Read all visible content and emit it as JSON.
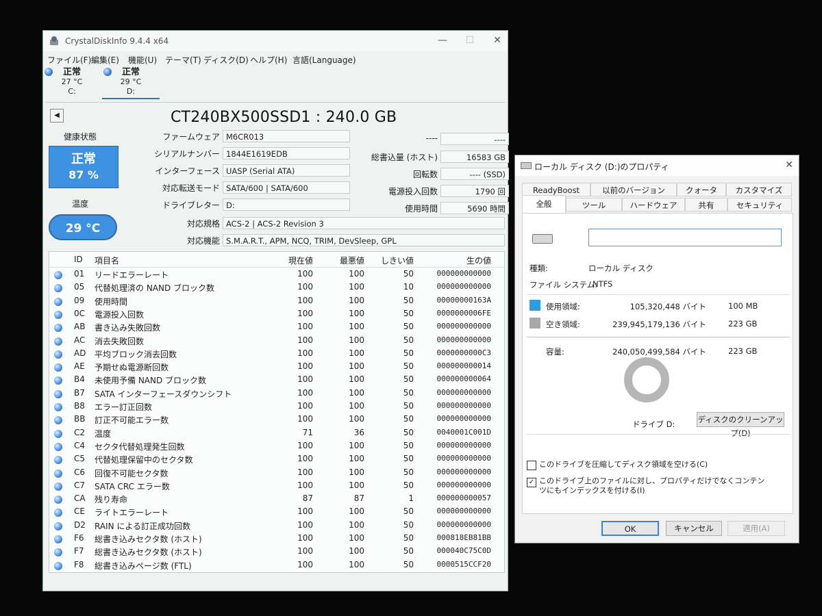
{
  "cdi": {
    "title": "CrystalDiskInfo 9.4.4 x64",
    "menu": [
      "ファイル(F)",
      "編集(E)",
      "機能(U)",
      "テーマ(T)",
      "ディスク(D)",
      "ヘルプ(H)",
      "言語(Language)"
    ],
    "drives": [
      {
        "status": "正常",
        "temp": "27 °C",
        "letter": "C:"
      },
      {
        "status": "正常",
        "temp": "29 °C",
        "letter": "D:"
      }
    ],
    "model": "CT240BX500SSD1 : 240.0 GB",
    "health_label": "健康状態",
    "health_status": "正常",
    "health_percent": "87 %",
    "temp_label": "温度",
    "temp_value": "29 °C",
    "left_fields": [
      {
        "label": "ファームウェア",
        "value": "M6CR013"
      },
      {
        "label": "シリアルナンバー",
        "value": "1844E1619EDB"
      },
      {
        "label": "インターフェース",
        "value": "UASP (Serial ATA)"
      },
      {
        "label": "対応転送モード",
        "value": "SATA/600 | SATA/600"
      },
      {
        "label": "ドライブレター",
        "value": "D:"
      }
    ],
    "right_fields": [
      {
        "label": "----",
        "value": "----"
      },
      {
        "label": "総書込量 (ホスト)",
        "value": "16583 GB"
      },
      {
        "label": "回転数",
        "value": "---- (SSD)"
      },
      {
        "label": "電源投入回数",
        "value": "1790 回"
      },
      {
        "label": "使用時間",
        "value": "5690 時間"
      }
    ],
    "standard_label": "対応規格",
    "standard_value": "ACS-2 | ACS-2 Revision 3",
    "features_label": "対応機能",
    "features_value": "S.M.A.R.T., APM, NCQ, TRIM, DevSleep, GPL",
    "smart_headers": {
      "id": "ID",
      "name": "項目名",
      "current": "現在値",
      "worst": "最悪値",
      "threshold": "しきい値",
      "raw": "生の値"
    },
    "smart_rows": [
      {
        "id": "01",
        "name": "リードエラーレート",
        "cur": "100",
        "worst": "100",
        "th": "50",
        "raw": "000000000000"
      },
      {
        "id": "05",
        "name": "代替処理済の NAND ブロック数",
        "cur": "100",
        "worst": "100",
        "th": "10",
        "raw": "000000000000"
      },
      {
        "id": "09",
        "name": "使用時間",
        "cur": "100",
        "worst": "100",
        "th": "50",
        "raw": "00000000163A"
      },
      {
        "id": "0C",
        "name": "電源投入回数",
        "cur": "100",
        "worst": "100",
        "th": "50",
        "raw": "0000000006FE"
      },
      {
        "id": "AB",
        "name": "書き込み失敗回数",
        "cur": "100",
        "worst": "100",
        "th": "50",
        "raw": "000000000000"
      },
      {
        "id": "AC",
        "name": "消去失敗回数",
        "cur": "100",
        "worst": "100",
        "th": "50",
        "raw": "000000000000"
      },
      {
        "id": "AD",
        "name": "平均ブロック消去回数",
        "cur": "100",
        "worst": "100",
        "th": "50",
        "raw": "0000000000C3"
      },
      {
        "id": "AE",
        "name": "予期せぬ電源断回数",
        "cur": "100",
        "worst": "100",
        "th": "50",
        "raw": "000000000014"
      },
      {
        "id": "B4",
        "name": "未使用予備 NAND ブロック数",
        "cur": "100",
        "worst": "100",
        "th": "50",
        "raw": "000000000064"
      },
      {
        "id": "B7",
        "name": "SATA インターフェースダウンシフト",
        "cur": "100",
        "worst": "100",
        "th": "50",
        "raw": "000000000000"
      },
      {
        "id": "B8",
        "name": "エラー訂正回数",
        "cur": "100",
        "worst": "100",
        "th": "50",
        "raw": "000000000000"
      },
      {
        "id": "BB",
        "name": "訂正不可能エラー数",
        "cur": "100",
        "worst": "100",
        "th": "50",
        "raw": "000000000000"
      },
      {
        "id": "C2",
        "name": "温度",
        "cur": "71",
        "worst": "36",
        "th": "50",
        "raw": "0040001C001D"
      },
      {
        "id": "C4",
        "name": "セクタ代替処理発生回数",
        "cur": "100",
        "worst": "100",
        "th": "50",
        "raw": "000000000000"
      },
      {
        "id": "C5",
        "name": "代替処理保留中のセクタ数",
        "cur": "100",
        "worst": "100",
        "th": "50",
        "raw": "000000000000"
      },
      {
        "id": "C6",
        "name": "回復不可能セクタ数",
        "cur": "100",
        "worst": "100",
        "th": "50",
        "raw": "000000000000"
      },
      {
        "id": "C7",
        "name": "SATA CRC エラー数",
        "cur": "100",
        "worst": "100",
        "th": "50",
        "raw": "000000000000"
      },
      {
        "id": "CA",
        "name": "残り寿命",
        "cur": "87",
        "worst": "87",
        "th": "1",
        "raw": "000000000057"
      },
      {
        "id": "CE",
        "name": "ライトエラーレート",
        "cur": "100",
        "worst": "100",
        "th": "50",
        "raw": "000000000000"
      },
      {
        "id": "D2",
        "name": "RAIN による訂正成功回数",
        "cur": "100",
        "worst": "100",
        "th": "50",
        "raw": "000000000000"
      },
      {
        "id": "F6",
        "name": "総書き込みセクタ数 (ホスト)",
        "cur": "100",
        "worst": "100",
        "th": "50",
        "raw": "000818EB81BB"
      },
      {
        "id": "F7",
        "name": "総書き込みセクタ数 (ホスト)",
        "cur": "100",
        "worst": "100",
        "th": "50",
        "raw": "000040C75C0D"
      },
      {
        "id": "F8",
        "name": "総書き込みページ数 (FTL)",
        "cur": "100",
        "worst": "100",
        "th": "50",
        "raw": "0000515CCF20"
      }
    ]
  },
  "props": {
    "title": "ローカル ディスク (D:)のプロパティ",
    "tabs_row1": [
      "ReadyBoost",
      "以前のバージョン",
      "クォータ",
      "カスタマイズ"
    ],
    "tabs_row2": [
      "全般",
      "ツール",
      "ハードウェア",
      "共有",
      "セキュリティ"
    ],
    "name_value": "",
    "type_label": "種類:",
    "type_value": "ローカル ディスク",
    "fs_label": "ファイル システム:",
    "fs_value": "NTFS",
    "used_label": "使用領域:",
    "used_bytes": "105,320,448 バイト",
    "used_size": "100 MB",
    "free_label": "空き領域:",
    "free_bytes": "239,945,179,136 バイト",
    "free_size": "223 GB",
    "cap_label": "容量:",
    "cap_bytes": "240,050,499,584 バイト",
    "cap_size": "223 GB",
    "drive_label": "ドライブ D:",
    "cleanup_button": "ディスクのクリーンアップ(D)",
    "compress_label": "このドライブを圧縮してディスク領域を空ける(C)",
    "index_label": "このドライブ上のファイルに対し、プロパティだけでなくコンテンツにもインデックスを付ける(I)",
    "ok": "OK",
    "cancel": "キャンセル",
    "apply": "適用(A)",
    "colors": {
      "used": "#2f9be0",
      "free": "#a8a8a8"
    }
  }
}
